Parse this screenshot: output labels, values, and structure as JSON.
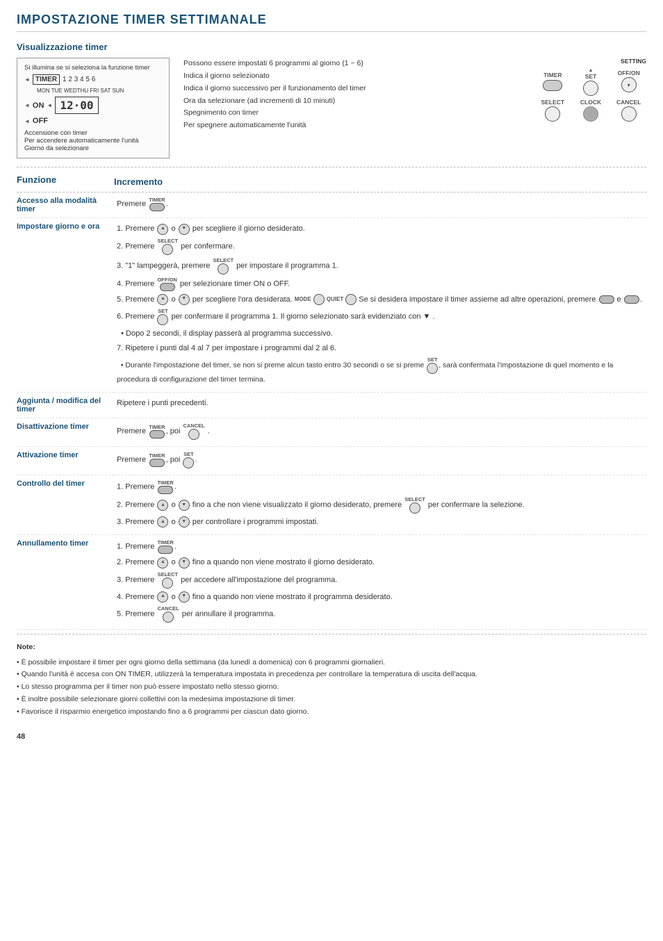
{
  "page": {
    "title": "IMPOSTAZIONE TIMER SETTIMANALE",
    "number": "48"
  },
  "sections": {
    "visualizzazione": {
      "title": "Visualizzazione timer",
      "left_caption1": "Si illumina se si seleziona la funzione timer",
      "left_caption2": "Accensione con timer",
      "left_caption3": "Per accendere automaticamente l'unità",
      "left_caption4": "Giorno da selezionare",
      "mid_line1": "Possono essere impostati 6 programmi al giorno (1 ~ 6)",
      "mid_line2": "Indica il giorno selezionato",
      "mid_line3": "Indica il giorno successivo per il funzionamento del timer",
      "mid_line4": "Ora da selezionare (ad incrementi di 10 minuti)",
      "mid_line5": "Spegnimento con timer",
      "mid_line6": "Per spegnere automaticamente l'unità",
      "display_text": "12·00",
      "timer_label": "TIMER",
      "days_label": "1 2 3 4 5 6",
      "days_sub": "MON TUE WEDTHU FRI SAT SUN",
      "on_label": "ON",
      "off_label": "OFF",
      "setting_label": "SETTING",
      "set_label": "SET",
      "offon_label": "OFF/ON",
      "select_label": "SELECT",
      "clock_label": "CLOCK",
      "cancel_label": "CANCEL"
    },
    "funzione_header": "Funzione",
    "incremento_header": "Incremento",
    "rows": [
      {
        "func": "Accesso alla modalità timer",
        "content": "Premere [TIMER]."
      },
      {
        "func": "Impostare giorno e ora",
        "steps": [
          "1. Premere [▲] o [▼] per scegliere il giorno desiderato.",
          "2. Premere [SELECT] per confermare.",
          "3. \"1\" lampeggerà, premere [SELECT] per impostare il programma 1.",
          "4. Premere [OFF/ON] per selezionare timer ON o OFF.",
          "5. Premere [▲] o [▼] per scegliere l'ora desiderata. Se si desidera impostare il timer assieme ad altre operazioni, premere [MODE] e [QUIET].",
          "6. Premere [SET] per confermare il programma 1. Il giorno selezionato sarà evidenziato con ▼ .",
          "• Dopo 2 secondi, il display passerà al programma successivo.",
          "7. Ripetere i punti dal 4 al 7 per impostare i programmi dal 2 al 6.",
          "• Durante l'impostazione del timer, se non si preme alcun tasto entro 30 secondi o se si preme [SET], sarà confermata l'impostazione di quel momento e la procedura di configurazione del timer termina."
        ]
      },
      {
        "func": "Aggiunta / modifica del timer",
        "content": "Ripetere i punti precedenti."
      },
      {
        "func": "Disattivazione timer",
        "content": "Premere [TIMER], poi [CANCEL]."
      },
      {
        "func": "Attivazione timer",
        "content": "Premere [TIMER], poi [SET]."
      },
      {
        "func": "Controllo del timer",
        "steps": [
          "1. Premere [TIMER].",
          "2. Premere [▲] o [▼] fino a che non viene visualizzato il giorno desiderato, premere [SELECT] per confermare la selezione.",
          "3. Premere [▲] o [▼] per controllare i programmi impostati."
        ]
      },
      {
        "func": "Annullamento timer",
        "steps": [
          "1. Premere [TIMER].",
          "2. Premere [▲] o [▼] fino a quando non viene mostrato il giorno desiderato.",
          "3. Premere [SELECT] per accedere all'impostazione del programma.",
          "4. Premere [▲] o [▼] fino a quando non viene mostrato il programma desiderato.",
          "5. Premere [CANCEL] per annullare il programma."
        ]
      }
    ],
    "notes": [
      "È possibile impostare il timer per ogni giorno della settimana (da lunedì a domenica) con 6 programmi giornalieri.",
      "Quando l'unità è accesa con ON TIMER, utilizzerà la temperatura impostata in precedenza per controllare la temperatura di uscita dell'acqua.",
      "Lo stesso programma per il timer non può essere impostato nello stesso giorno.",
      "È inoltre possibile selezionare giorni collettivi con la medesima impostazione di timer.",
      "Favorisce il risparmio energetico impostando fino a 6 programmi per ciascun dato giorno."
    ]
  }
}
